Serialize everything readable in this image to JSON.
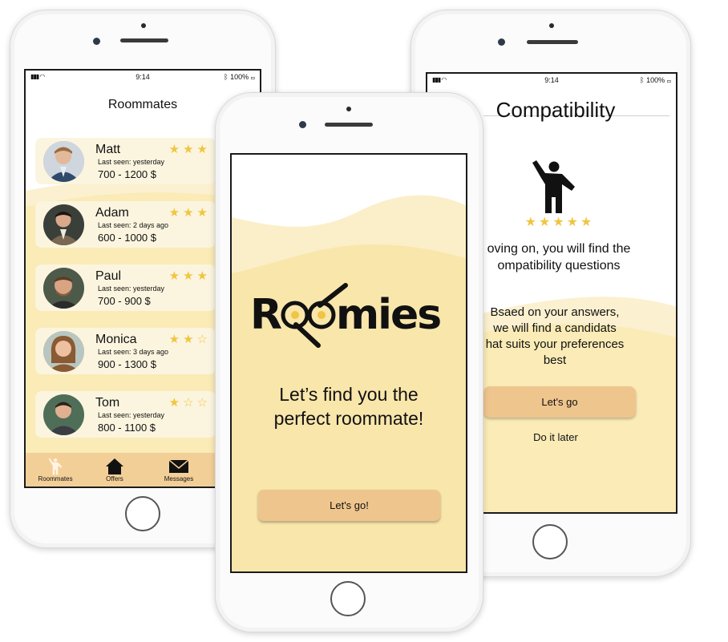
{
  "status_bar": {
    "time": "9:14",
    "battery": "100%"
  },
  "roommates_screen": {
    "title": "Roommates",
    "people": [
      {
        "name": "Matt",
        "seen": "Last seen: yesterday",
        "price": "700 - 1200 $",
        "rating": 3,
        "stars": "★★★"
      },
      {
        "name": "Adam",
        "seen": "Last seen: 2 days ago",
        "price": "600 - 1000 $",
        "rating": 3,
        "stars": "★★★"
      },
      {
        "name": "Paul",
        "seen": "Last seen: yesterday",
        "price": "700 - 900 $",
        "rating": 3,
        "stars": "★★★"
      },
      {
        "name": "Monica",
        "seen": "Last seen: 3 days ago",
        "price": "900 - 1300 $",
        "rating": 2,
        "stars": "★★☆"
      },
      {
        "name": "Tom",
        "seen": "Last seen: yesterday",
        "price": "800 - 1100 $",
        "rating": 1,
        "stars": "★☆☆"
      }
    ],
    "tabs": [
      {
        "label": "Roommates",
        "icon": "person-waving-icon"
      },
      {
        "label": "Offers",
        "icon": "home-icon"
      },
      {
        "label": "Messages",
        "icon": "envelope-icon"
      }
    ]
  },
  "splash_screen": {
    "logo": "Roomies",
    "tagline_line1": "Let’s find you the",
    "tagline_line2": "perfect roommate!",
    "button": "Let's go!"
  },
  "compatibility_screen": {
    "title": "Compatibility",
    "icon": "person-waving-icon",
    "rating": 5,
    "stars": "★★★★★",
    "text1_line1": "oving on, you will find the",
    "text1_line2": "ompatibility questions",
    "text2_line1": "Bsaed on your answers,",
    "text2_line2": "we will find a candidats",
    "text2_line3": "hat suits your preferences",
    "text2_line4": "best",
    "button": "Let's go",
    "secondary": "Do it later"
  },
  "colors": {
    "pale_yellow": "#faebb7",
    "light_yellow": "#fbf5df",
    "tan": "#f3cf98",
    "button": "#efc58e",
    "star": "#f1c541"
  }
}
